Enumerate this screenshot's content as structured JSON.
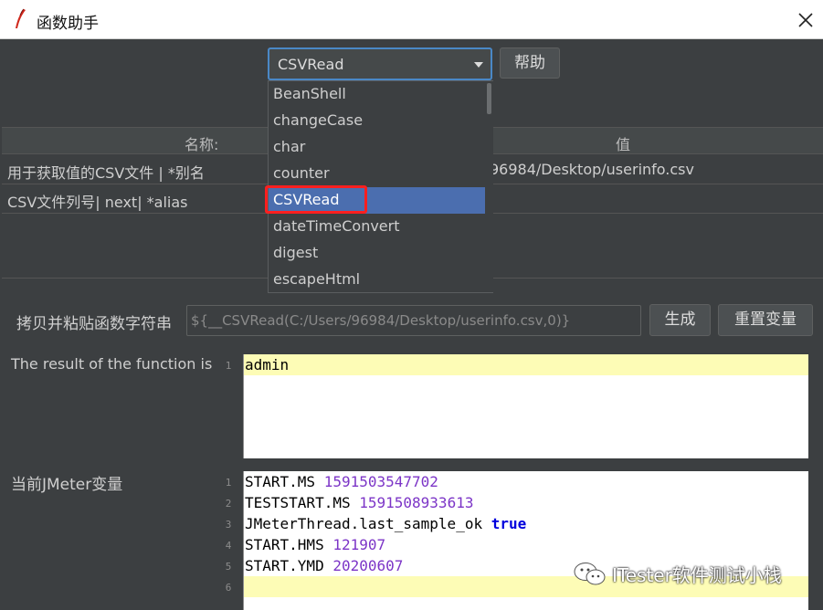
{
  "window": {
    "title": "函数助手",
    "icon": "feather-icon",
    "close_icon": "close-icon"
  },
  "function_select": {
    "selected": "CSVRead",
    "options": [
      "BeanShell",
      "changeCase",
      "char",
      "counter",
      "CSVRead",
      "dateTimeConvert",
      "digest",
      "escapeHtml"
    ]
  },
  "help_button": "帮助",
  "params_table": {
    "col_name": "名称:",
    "col_value": "值",
    "rows": [
      {
        "name": "用于获取值的CSV文件 | *别名",
        "value": "96984/Desktop/userinfo.csv"
      },
      {
        "name": "CSV文件列号| next| *alias",
        "value": ""
      }
    ]
  },
  "copy_section": {
    "label": "拷贝并粘贴函数字符串",
    "value": "${__CSVRead(C:/Users/96984/Desktop/userinfo.csv,0)}",
    "generate_button": "生成",
    "reset_button": "重置变量"
  },
  "result": {
    "label": "The result of the function is",
    "lines": [
      {
        "num": "1",
        "text": "admin"
      }
    ]
  },
  "vars": {
    "label": "当前JMeter变量",
    "lines": [
      {
        "num": "1",
        "key": "START.MS",
        "value": "1591503547702"
      },
      {
        "num": "2",
        "key": "TESTSTART.MS",
        "value": "1591508933613"
      },
      {
        "num": "3",
        "key": "JMeterThread.last_sample_ok",
        "value": "true"
      },
      {
        "num": "4",
        "key": "START.HMS",
        "value": "121907"
      },
      {
        "num": "5",
        "key": "START.YMD",
        "value": "20200607"
      },
      {
        "num": "6",
        "key": "",
        "value": ""
      }
    ]
  },
  "watermark": {
    "text": "ITester软件测试小栈",
    "icon": "wechat-icon"
  },
  "colors": {
    "background": "#3c3f41",
    "selection": "#4b6eaf",
    "highlight_box": "#ff1f1f",
    "current_line": "#fdfcb6",
    "number": "#7c35c7",
    "keyword": "#0000dd"
  }
}
